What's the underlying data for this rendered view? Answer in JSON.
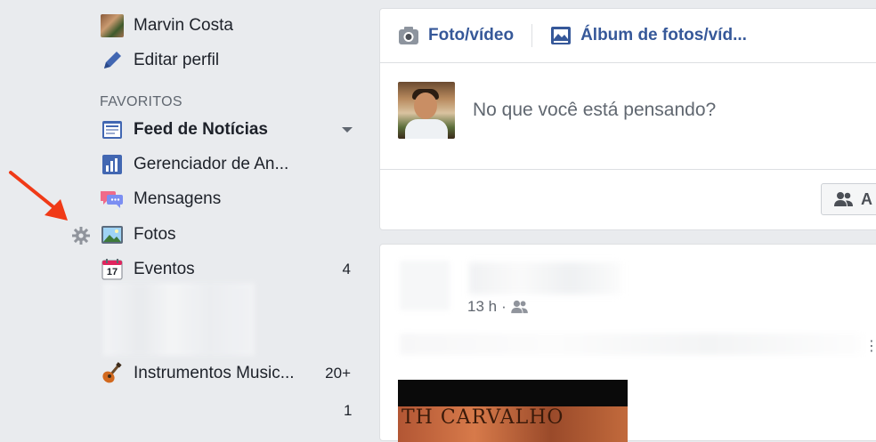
{
  "sidebar": {
    "profile": {
      "name": "Marvin Costa",
      "edit_label": "Editar perfil"
    },
    "favorites_heading": "FAVORITOS",
    "items": [
      {
        "label": "Feed de Notícias",
        "icon": "news-feed-icon",
        "count": ""
      },
      {
        "label": "Gerenciador de An...",
        "icon": "bar-chart-icon",
        "count": ""
      },
      {
        "label": "Mensagens",
        "icon": "messages-icon",
        "count": ""
      },
      {
        "label": "Fotos",
        "icon": "photos-icon",
        "count": ""
      },
      {
        "label": "Eventos",
        "icon": "calendar-icon",
        "count": "4"
      },
      {
        "label": "Instrumentos Music...",
        "icon": "guitar-icon",
        "count": "20+"
      }
    ],
    "extra_count": "1",
    "calendar_day": "17"
  },
  "composer": {
    "tabs": [
      {
        "label": "Foto/vídeo",
        "icon": "camera-icon"
      },
      {
        "label": "Álbum de fotos/víd...",
        "icon": "photo-album-icon"
      }
    ],
    "placeholder": "No que você está pensando?",
    "audience_initial": "A"
  },
  "post": {
    "time": "13 h",
    "separator": "·",
    "image_text": "TH CARVALHO"
  },
  "colors": {
    "background": "#e9ebee",
    "link_blue": "#365899",
    "facebook_blue": "#4267b2",
    "arrow_red": "#f03a17",
    "muted_text": "#606770"
  }
}
